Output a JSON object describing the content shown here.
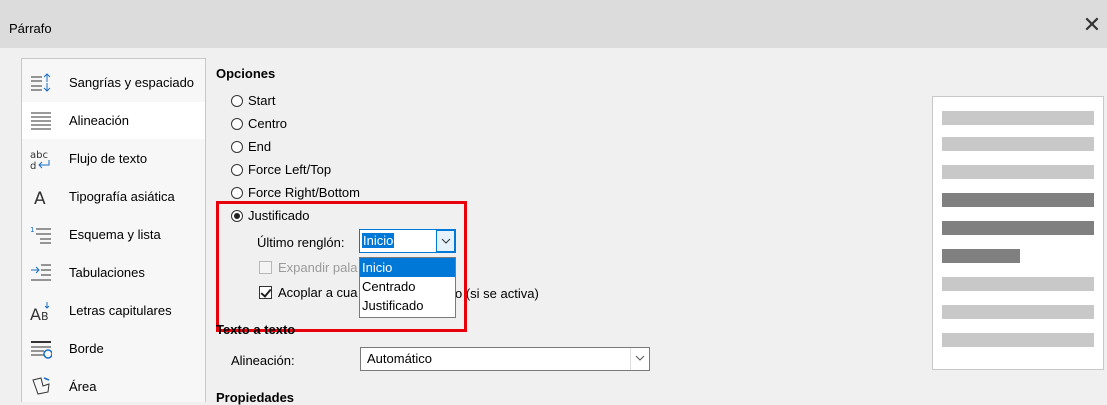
{
  "window": {
    "title": "Párrafo"
  },
  "sidebar": {
    "items": [
      {
        "label": "Sangrías y espaciado",
        "icon": "indent-spacing-icon"
      },
      {
        "label": "Alineación",
        "icon": "align-justify-icon",
        "active": true
      },
      {
        "label": "Flujo de texto",
        "icon": "text-flow-icon"
      },
      {
        "label": "Tipografía asiática",
        "icon": "asian-typography-icon"
      },
      {
        "label": "Esquema y lista",
        "icon": "outline-list-icon"
      },
      {
        "label": "Tabulaciones",
        "icon": "tabs-icon"
      },
      {
        "label": "Letras capitulares",
        "icon": "drop-caps-icon"
      },
      {
        "label": "Borde",
        "icon": "border-icon"
      },
      {
        "label": "Área",
        "icon": "area-icon"
      }
    ]
  },
  "options": {
    "heading": "Opciones",
    "radios": [
      {
        "label": "Start",
        "checked": false
      },
      {
        "label": "Centro",
        "checked": false
      },
      {
        "label": "End",
        "checked": false
      },
      {
        "label": "Force Left/Top",
        "checked": false
      },
      {
        "label": "Force Right/Bottom",
        "checked": false
      },
      {
        "label": "Justificado",
        "checked": true
      }
    ],
    "last_line_label": "Último renglón:",
    "last_line_value": "Inicio",
    "last_line_options": [
      "Inicio",
      "Centrado",
      "Justificado"
    ],
    "expand_word_label": "Expandir pala",
    "snap_label_left": "Acoplar a cua",
    "snap_label_right": "o (si se activa)"
  },
  "text_to_text": {
    "heading": "Texto a texto",
    "alignment_label": "Alineación:",
    "alignment_value": "Automático"
  },
  "properties": {
    "heading": "Propiedades"
  },
  "colors": {
    "highlight": "#e8000b",
    "selection": "#0078d7"
  }
}
